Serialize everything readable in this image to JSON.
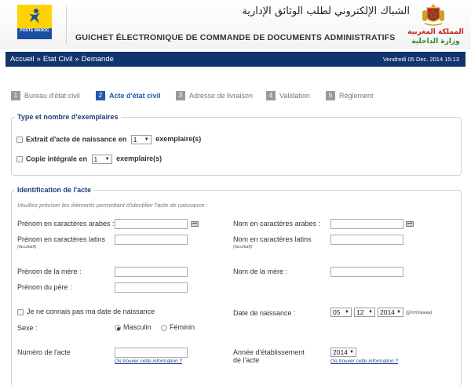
{
  "header": {
    "logo_text": "POSTE MAROC",
    "arabic_title": "الشباك الإلكتروني لطلب الوثائق الإدارية",
    "french_title": "GUICHET ÉLECTRONIQUE DE COMMANDE DE DOCUMENTS ADMINISTRATIFS",
    "kingdom": "المملكة المغربية",
    "ministry": "وزارة الداخلية"
  },
  "navbar": {
    "breadcrumb": [
      "Accueil",
      "Etat Civil",
      "Demande"
    ],
    "separator": "»",
    "datetime": "Vendredi 05 Dec. 2014 15:13"
  },
  "steps": [
    {
      "num": "1",
      "label": "Bureau d'état civil",
      "active": false
    },
    {
      "num": "2",
      "label": "Acte d'état civil",
      "active": true
    },
    {
      "num": "3",
      "label": "Adresse de livraison",
      "active": false
    },
    {
      "num": "4",
      "label": "Validation",
      "active": false
    },
    {
      "num": "5",
      "label": "Réglement",
      "active": false
    }
  ],
  "type_section": {
    "legend": "Type et nombre d'exemplaires",
    "extrait_label": "Extrait d'acte de naissance en",
    "extrait_value": "1",
    "extrait_suffix": "exemplaire(s)",
    "copie_label": "Copie intégrale en",
    "copie_value": "1",
    "copie_suffix": "exemplaire(s)"
  },
  "ident_section": {
    "legend": "Identification de l'acte",
    "note": "Veuillez préciser les éléments permettant d'identifier l'acte de naissance :",
    "prenom_ar": "Prénom en caractères arabes :",
    "nom_ar": "Nom en caractères arabes :",
    "prenom_lat": "Prénom en caractères latins",
    "nom_lat": "Nom en caractères latins",
    "facultatif": "(facultatif)",
    "prenom_mere": "Prénom de la mère :",
    "nom_mere": "Nom de la mère :",
    "prenom_pere": "Prénom du père :",
    "unknown_date": "Je ne connais pas ma date de naissance",
    "date_naissance": "Date de naissance :",
    "date_day": "05",
    "date_month": "12",
    "date_year": "2014",
    "date_format": "(jj/mm/aaaa)",
    "sexe": "Sexe :",
    "masculin": "Masculin",
    "feminin": "Féminin",
    "num_acte": "Numéro de l'acte",
    "help_link": "Où trouver cette information ?",
    "annee_label_1": "Année d'établissement",
    "annee_label_2": "de l'acte",
    "annee_value": "2014"
  }
}
